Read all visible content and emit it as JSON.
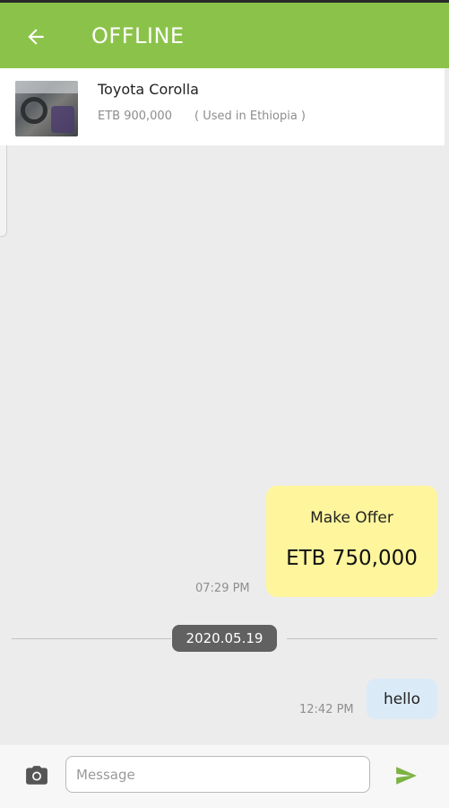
{
  "header": {
    "title": "OFFLINE",
    "back_icon": "arrow-left-icon",
    "color": "#8bc34a"
  },
  "product": {
    "title": "Toyota Corolla",
    "price": "ETB 900,000",
    "condition": "( Used in Ethiopia )"
  },
  "messages": [
    {
      "type": "offer",
      "label": "Make Offer",
      "amount": "ETB 750,000",
      "time": "07:29 PM",
      "bubble_color": "#fff59d"
    },
    {
      "type": "text",
      "text": "hello",
      "time": "12:42 PM",
      "bubble_color": "#dbeaf7"
    }
  ],
  "date_separator": "2020.05.19",
  "composer": {
    "placeholder": "Message",
    "value": "",
    "camera_icon": "camera-icon",
    "send_icon": "send-icon",
    "send_color": "#7cb342"
  }
}
